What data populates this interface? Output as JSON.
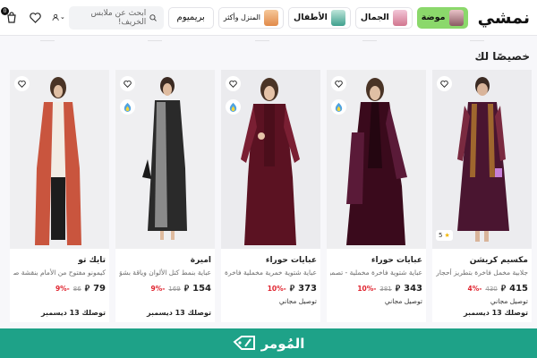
{
  "header": {
    "logo": "نمشي",
    "categories": [
      {
        "label": "موضة",
        "active": true
      },
      {
        "label": "الجمال",
        "active": false
      },
      {
        "label": "الأطفال",
        "active": false
      },
      {
        "label": "المنزل وأكثر",
        "active": false
      }
    ],
    "premium_label": "بريميوم",
    "search_placeholder": "ابحث عن ملابس الخريف!",
    "cart_count": "0"
  },
  "section": {
    "title": "خصيصًا لك"
  },
  "products": [
    {
      "brand": "مكسيم كريشن",
      "desc": "جلابية مخمل فاخرة بتطريز أحجار كريستا...",
      "price": "415",
      "old_price": "430",
      "discount": "-4%",
      "shipping": "توصيل مجاني",
      "eta": "توصلك 13 ديسمبر",
      "rating": "5",
      "accent": "#4a1530"
    },
    {
      "brand": "عبايات حوراء",
      "desc": "عباية شتوية فاخرة مخملية - تصميم...",
      "price": "343",
      "old_price": "381",
      "discount": "-10%",
      "shipping": "توصيل مجاني",
      "eta": "",
      "rating": "",
      "accent": "#3a0a1c"
    },
    {
      "brand": "عبايات حوراء",
      "desc": "عباية شتوية خمرية مخملية فاخرة -...",
      "price": "373",
      "old_price": "",
      "discount": "-10%",
      "shipping": "توصيل مجاني",
      "eta": "",
      "rating": "",
      "accent": "#5b1222"
    },
    {
      "brand": "أميرة",
      "desc": "عباية بنمط كتل الألوان وياقة بشق",
      "price": "154",
      "old_price": "169",
      "discount": "-9%",
      "shipping": "",
      "eta": "توصلك 13 ديسمبر",
      "rating": "",
      "accent": "#2a2a2a"
    },
    {
      "brand": "تايك تو",
      "desc": "كيمونو مفتوح من الأمام بنقشة صدفة",
      "price": "79",
      "old_price": "86",
      "discount": "-9%",
      "shipping": "",
      "eta": "توصلك 13 ديسمبر",
      "rating": "",
      "accent": "#c9553e"
    }
  ],
  "footer": {
    "brand_text": "المُومر"
  },
  "colors": {
    "active_category": "#8bd86b",
    "discount": "#e0242f",
    "footer_band": "#1ea288"
  }
}
